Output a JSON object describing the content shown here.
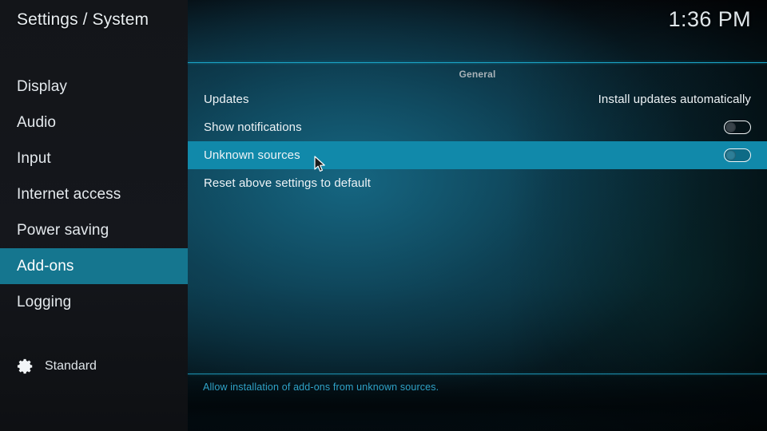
{
  "window": {
    "title": "Settings / System",
    "clock": "1:36 PM"
  },
  "sidebar": {
    "items": [
      {
        "label": "Display",
        "selected": false
      },
      {
        "label": "Audio",
        "selected": false
      },
      {
        "label": "Input",
        "selected": false
      },
      {
        "label": "Internet access",
        "selected": false
      },
      {
        "label": "Power saving",
        "selected": false
      },
      {
        "label": "Add-ons",
        "selected": true
      },
      {
        "label": "Logging",
        "selected": false
      }
    ],
    "level": {
      "icon": "gear-icon",
      "label": "Standard"
    }
  },
  "content": {
    "group_header": "General",
    "rows": [
      {
        "label": "Updates",
        "control": "value",
        "value": "Install updates automatically",
        "selected": false
      },
      {
        "label": "Show notifications",
        "control": "toggle",
        "value": "off",
        "selected": false
      },
      {
        "label": "Unknown sources",
        "control": "toggle",
        "value": "off",
        "selected": true
      },
      {
        "label": "Reset above settings to default",
        "control": "none",
        "value": "",
        "selected": false
      }
    ]
  },
  "footer": {
    "help_text": "Allow installation of add-ons from unknown sources."
  },
  "colors": {
    "highlight_row": "#1189aa",
    "highlight_nav": "#15768f",
    "divider": "#1aa7c9",
    "help_text": "#2fa3c8",
    "sidebar_bg": "#15171c"
  }
}
